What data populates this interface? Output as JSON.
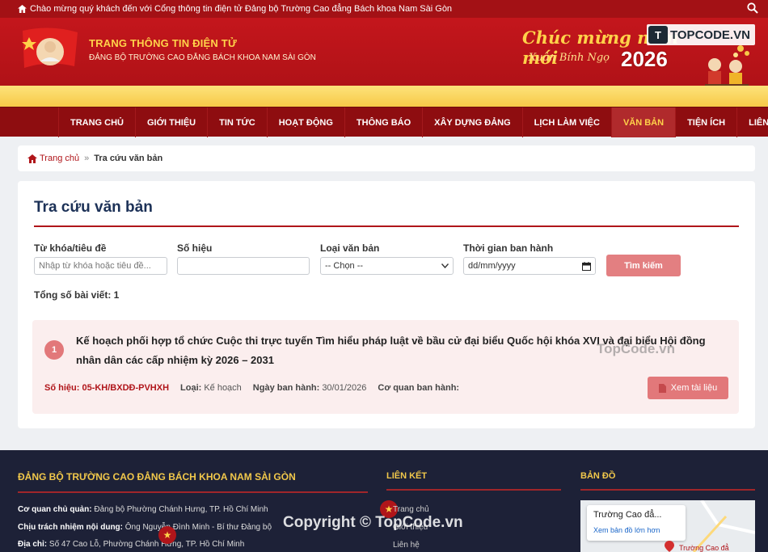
{
  "topbar": {
    "welcome": "Chào mừng quý khách đến với Cổng thông tin điện tử Đảng bộ Trường Cao đẳng Bách khoa Nam Sài Gòn"
  },
  "header": {
    "title": "TRANG THÔNG TIN ĐIỆN TỬ",
    "subtitle": "ĐẢNG BỘ TRƯỜNG CAO ĐẲNG BÁCH KHOA NAM SÀI GÒN",
    "greeting_line1": "Chúc mừng năm mới",
    "greeting_line2": "Xuân Bính Ngọ",
    "greeting_year": "2026",
    "topcode_mark": "T",
    "topcode_text": "TOPCODE.VN"
  },
  "nav": {
    "items": [
      {
        "label": "TRANG CHỦ"
      },
      {
        "label": "GIỚI THIỆU"
      },
      {
        "label": "TIN TỨC"
      },
      {
        "label": "HOẠT ĐỘNG"
      },
      {
        "label": "THÔNG BÁO"
      },
      {
        "label": "XÂY DỰNG ĐẢNG"
      },
      {
        "label": "LỊCH LÀM VIỆC"
      },
      {
        "label": "VĂN BẢN"
      },
      {
        "label": "TIỆN ÍCH"
      },
      {
        "label": "LIÊN HỆ"
      }
    ],
    "active_index": 7
  },
  "breadcrumb": {
    "home": "Trang chủ",
    "separator": "»",
    "current": "Tra cứu văn bản"
  },
  "search": {
    "title": "Tra cứu văn bản",
    "keyword_label": "Từ khóa/tiêu đề",
    "keyword_placeholder": "Nhập từ khóa hoặc tiêu đề...",
    "number_label": "Số hiệu",
    "number_value": "",
    "type_label": "Loại văn bản",
    "type_selected": "-- Chọn --",
    "date_label": "Thời gian ban hành",
    "date_value": "dd/mm/yyyy",
    "submit_label": "Tìm kiếm",
    "total_label": "Tổng số bài viết: 1"
  },
  "results": [
    {
      "index": "1",
      "title": "Kế hoạch phối hợp tổ chức Cuộc thi trực tuyến Tìm hiểu pháp luật về bầu cử đại biểu Quốc hội khóa XVI và đại biểu Hội đồng nhân dân các cấp nhiệm kỳ 2026 – 2031",
      "number_label": "Số hiệu:",
      "number": "05-KH/BXDĐ-PVHXH",
      "type_label": "Loại:",
      "type": "Kế hoạch",
      "date_label": "Ngày ban hành:",
      "date": "30/01/2026",
      "agency_label": "Cơ quan ban hành:",
      "agency": "",
      "view_label": "Xem tài liệu"
    }
  ],
  "watermarks": {
    "card": "TopCode.vn",
    "footer": "Copyright © TopCode.vn"
  },
  "footer": {
    "org_title": "ĐẢNG BỘ TRƯỜNG CAO ĐẲNG BÁCH KHOA NAM SÀI GÒN",
    "owner_label": "Cơ quan chủ quản:",
    "owner": "Đảng bộ Phường Chánh Hưng, TP. Hồ Chí Minh",
    "editor_label": "Chịu trách nhiệm nội dung:",
    "editor": "Ông Nguyễn Đình Minh - Bí thư Đảng bộ",
    "address_label": "Địa chỉ:",
    "address": "Số 47 Cao Lỗ, Phường Chánh Hưng, TP. Hồ Chí Minh",
    "links_title": "LIÊN KẾT",
    "links": [
      "Trang chủ",
      "Giới thiệu",
      "Liên hệ"
    ],
    "map_title": "BẢN ĐỒ",
    "map_place": "Trường Cao đẳ...",
    "map_link": "Xem bản đồ lớn hơn",
    "map_pin_label": "Trường Cao đẳ"
  },
  "colors": {
    "primary_red": "#b0151a",
    "gold": "#f7c948",
    "navy_title": "#1c3157",
    "footer_bg": "#1d2137"
  }
}
